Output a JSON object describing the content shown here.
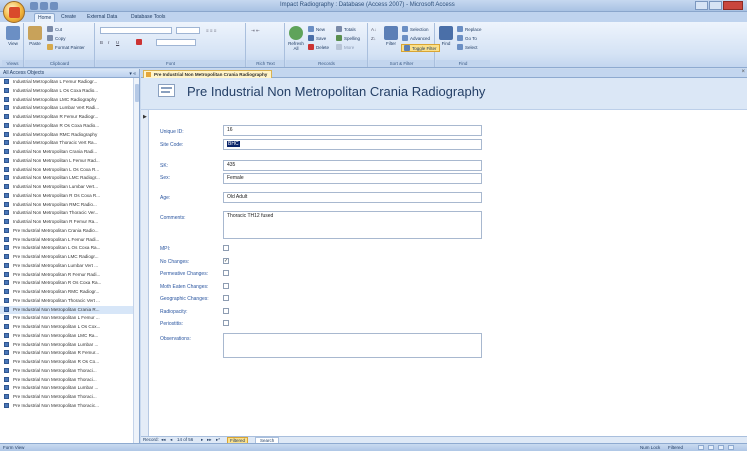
{
  "window": {
    "title": "Impact Radiography : Database (Access 2007) - Microsoft Access",
    "controls": [
      "minimize",
      "restore",
      "close"
    ]
  },
  "ribbon": {
    "tabs": [
      "Home",
      "Create",
      "External Data",
      "Database Tools"
    ],
    "active_tab": "Home",
    "groups": {
      "views": {
        "label": "Views",
        "view_button": "View"
      },
      "clipboard": {
        "label": "Clipboard",
        "paste": "Paste",
        "cut": "Cut",
        "copy": "Copy",
        "format_painter": "Format Painter"
      },
      "font": {
        "label": "Font"
      },
      "rich_text": {
        "label": "Rich Text"
      },
      "records": {
        "label": "Records",
        "refresh": "Refresh All",
        "new": "New",
        "save": "Save",
        "delete": "Delete",
        "totals": "Totals",
        "spelling": "Spelling",
        "more": "More"
      },
      "sort_filter": {
        "label": "Sort & Filter",
        "filter": "Filter",
        "selection": "Selection",
        "advanced": "Advanced",
        "toggle_filter": "Toggle Filter"
      },
      "find": {
        "label": "Find",
        "find": "Find",
        "replace": "Replace",
        "goto": "Go To",
        "select": "Select"
      }
    }
  },
  "nav_pane": {
    "header": "All Access Objects",
    "items": [
      "Industrial Metropolitan L Femur Radiogr...",
      "Industrial Metropolitan L Os Coxa Radio...",
      "Industrial Metropolitan LMC Radiography",
      "Industrial Metropolitan Lumbar Vert Radi...",
      "Industrial Metropolitan R Femur Radiogr...",
      "Industrial Metropolitan R Os Coxa Radio...",
      "Industrial Metropolitan RMC Radiography",
      "Industrial Metropolitan Thoracic Vert Ra...",
      "Industrial Non Metropolitan Crania Radi...",
      "Industrial Non Metropolitan L Femur Rad...",
      "Industrial Non Metropolitan L Os Coxa R...",
      "Industrial Non Metropolitan LMC Radiogr...",
      "Industrial Non Metropolitan Lumbar Vert...",
      "Industrial Non Metropolitan R Os Coxa R...",
      "Industrial Non Metropolitan RMC Radio...",
      "Industrial Non Metropolitan Thoracic Ver...",
      "Industrial Non Metropolitan R Femur Ra...",
      "Pre Industrial Metropolitan Crania Radio...",
      "Pre Industrial Metropolitan L Femur Radi...",
      "Pre Industrial Metropolitan L Os Coxa Ra...",
      "Pre Industrial Metropolitan LMC Radiogr...",
      "Pre Industrial Metropolitan Lumbar Vert ...",
      "Pre Industrial Metropolitan R Femur Radi...",
      "Pre Industrial Metropolitan R Os Coxa Ra...",
      "Pre Industrial Metropolitan RMC Radiogr...",
      "Pre Industrial Metropolitan Thoracic Vert ...",
      "Pre Industrial Non Metropolitan Crania R...",
      "Pre Industrial Non Metropolitan L Femur ...",
      "Pre Industrial Non Metropolitan L Os Cox...",
      "Pre Industrial Non Metropolitan LMC Ra...",
      "Pre Industrial Non Metropolitan Lumbar ...",
      "Pre Industrial Non Metropolitan R Femur...",
      "Pre Industrial Non Metropolitan R Os Co...",
      "Pre Industrial Non Metropolitan Thoraci...",
      "Pre Industrial Non Metropolitan Thoraci...",
      "Pre Industrial Non Metropolitan Lumbar ...",
      "Pre Industrial Non Metropolitan Thoraci...",
      "Pre Industrial Non Metropolitan Thoracic..."
    ],
    "selected_index": 26
  },
  "document": {
    "tab_label": "Pre Industrial Non Metropolitan Crania Radiography",
    "form_title": "Pre Industrial Non Metropolitan Crania Radiography",
    "fields": {
      "unique_id": {
        "label": "Unique ID:",
        "value": "16"
      },
      "site_code": {
        "label": "Site Code:",
        "value": "BHC"
      },
      "sk": {
        "label": "SK:",
        "value": "435"
      },
      "sex": {
        "label": "Sex:",
        "value": "Female"
      },
      "age": {
        "label": "Age:",
        "value": "Old Adult"
      },
      "comments": {
        "label": "Comments:",
        "value": "Thoracic TH12 fused"
      }
    },
    "checkboxes": [
      {
        "key": "mpi",
        "label": "MPI:",
        "checked": false
      },
      {
        "key": "no_changes",
        "label": "No Changes:",
        "checked": true
      },
      {
        "key": "permeative",
        "label": "Permeative Changes:",
        "checked": false
      },
      {
        "key": "moth_eaten",
        "label": "Moth Eaten Changes:",
        "checked": false
      },
      {
        "key": "geographic",
        "label": "Geographic Changes:",
        "checked": false
      },
      {
        "key": "radiopacity",
        "label": "Radiopacity:",
        "checked": false
      },
      {
        "key": "periostitis",
        "label": "Periostitis:",
        "checked": false
      }
    ],
    "observations_label": "Observations:",
    "observations_value": ""
  },
  "record_nav": {
    "label": "Record:",
    "position": "14 of 56",
    "filter": "Filtered",
    "search": "Search"
  },
  "status_bar": {
    "left": "Form View",
    "right_numlock": "Num Lock",
    "right_filtered": "Filtered"
  },
  "colors": {
    "accent": "#2b56a0",
    "ribbon": "#d5e3f5",
    "toggle_filter": "#fbe08a"
  }
}
